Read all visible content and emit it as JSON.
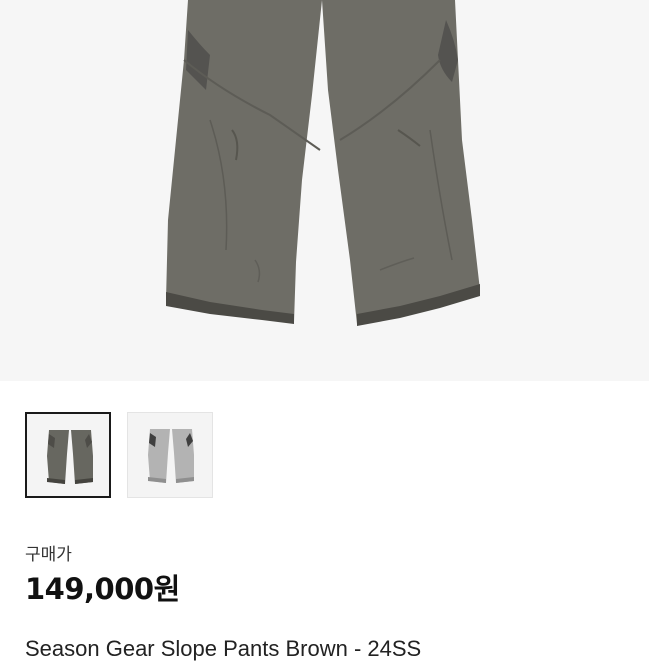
{
  "product": {
    "image_alt": "Season Gear Slope Pants Brown - 24SS",
    "thumbnails": [
      {
        "name": "brown",
        "color": "#676760",
        "selected": true
      },
      {
        "name": "light-grey",
        "color": "#b3b3b3",
        "selected": false
      }
    ],
    "price_label": "구매가",
    "price": "149,000원",
    "title": "Season Gear Slope Pants Brown - 24SS"
  }
}
